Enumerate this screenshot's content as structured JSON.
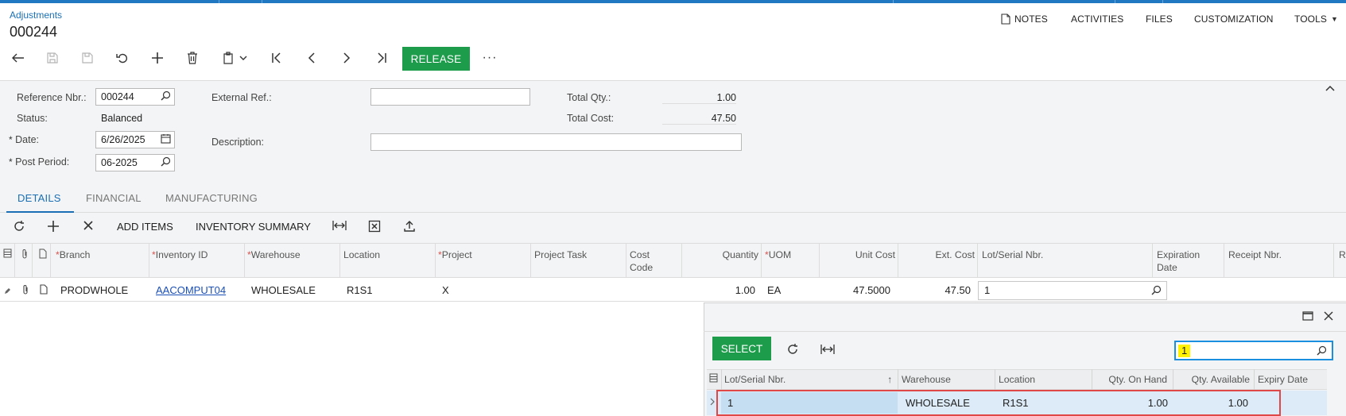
{
  "header": {
    "breadcrumb": "Adjustments",
    "doc_number": "000244",
    "menu": {
      "notes": "NOTES",
      "activities": "ACTIVITIES",
      "files": "FILES",
      "customization": "CUSTOMIZATION",
      "tools": "TOOLS"
    }
  },
  "toolbar": {
    "release_label": "RELEASE",
    "more_label": "···"
  },
  "form": {
    "reference_nbr_label": "Reference Nbr.:",
    "reference_nbr_value": "000244",
    "status_label": "Status:",
    "status_value": "Balanced",
    "date_label": "Date:",
    "date_value": "6/26/2025",
    "post_period_label": "Post Period:",
    "post_period_value": "06-2025",
    "external_ref_label": "External Ref.:",
    "external_ref_value": "",
    "description_label": "Description:",
    "description_value": "",
    "total_qty_label": "Total Qty.:",
    "total_qty_value": "1.00",
    "total_cost_label": "Total Cost:",
    "total_cost_value": "47.50",
    "required_mark": "*"
  },
  "tabs": {
    "details": "DETAILS",
    "financial": "FINANCIAL",
    "manufacturing": "MANUFACTURING"
  },
  "grid_toolbar": {
    "add_items": "ADD ITEMS",
    "inventory_summary": "INVENTORY SUMMARY"
  },
  "grid": {
    "columns": {
      "branch": "Branch",
      "inventory_id": "Inventory ID",
      "warehouse": "Warehouse",
      "location": "Location",
      "project": "Project",
      "project_task": "Project Task",
      "cost_code_1": "Cost",
      "cost_code_2": "Code",
      "quantity": "Quantity",
      "uom": "UOM",
      "unit_cost": "Unit Cost",
      "ext_cost": "Ext. Cost",
      "lot_serial": "Lot/Serial Nbr.",
      "expiration_1": "Expiration",
      "expiration_2": "Date",
      "receipt_nbr": "Receipt Nbr.",
      "cut": "R"
    },
    "row": {
      "branch": "PRODWHOLE",
      "inventory_id": "AACOMPUT04",
      "warehouse": "WHOLESALE",
      "location": "R1S1",
      "project": "X",
      "project_task": "",
      "cost_code": "",
      "quantity": "1.00",
      "uom": "EA",
      "unit_cost": "47.5000",
      "ext_cost": "47.50",
      "lot_serial": "1"
    }
  },
  "lookup": {
    "select_label": "SELECT",
    "search_value": "1",
    "columns": {
      "lot_serial": "Lot/Serial Nbr.",
      "warehouse": "Warehouse",
      "location": "Location",
      "qty_on_hand": "Qty. On Hand",
      "qty_available": "Qty. Available",
      "expiry_date": "Expiry Date"
    },
    "row": {
      "lot_serial": "1",
      "warehouse": "WHOLESALE",
      "location": "R1S1",
      "qty_on_hand": "1.00",
      "qty_available": "1.00",
      "expiry_date": ""
    }
  },
  "colors": {
    "accent": "#1a6fb5",
    "primary_button": "#1d9d4b",
    "highlight_box": "#e04848",
    "search_highlight": "#fff200"
  }
}
